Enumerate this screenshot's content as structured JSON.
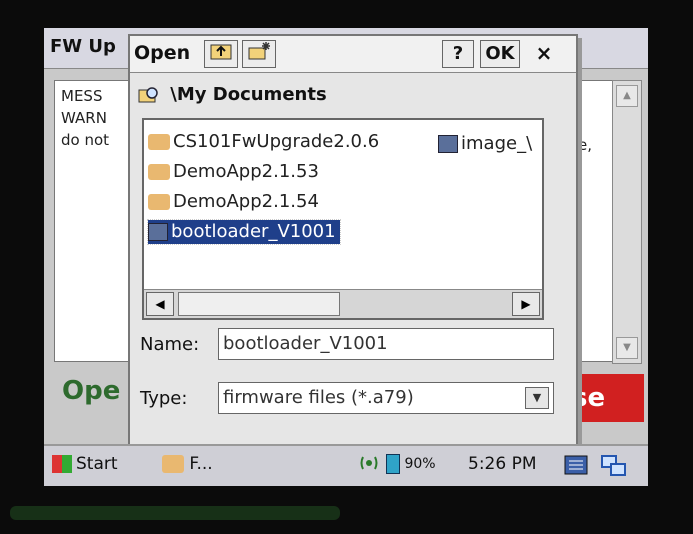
{
  "background_app": {
    "title": "FW Up",
    "lines": [
      "MESS",
      "WARN",
      "do not"
    ],
    "right_text": "e,",
    "open_button": "Ope",
    "close_button": "se",
    "scroll_up": "▲",
    "scroll_down": "▼"
  },
  "dialog": {
    "title": "Open",
    "help_label": "?",
    "ok_label": "OK",
    "close_label": "×",
    "path": "\\My Documents",
    "files": [
      {
        "name": "CS101FwUpgrade2.0.6",
        "type": "folder"
      },
      {
        "name": "DemoApp2.1.53",
        "type": "folder"
      },
      {
        "name": "DemoApp2.1.54",
        "type": "folder"
      },
      {
        "name": "bootloader_V1001",
        "type": "file",
        "selected": true
      },
      {
        "name": "image_\\",
        "type": "file"
      }
    ],
    "scroll_left": "◀",
    "scroll_right": "▶",
    "name_label": "Name:",
    "name_value": "bootloader_V1001",
    "type_label": "Type:",
    "type_value": "firmware files (*.a79)",
    "type_dropdown_icon": "▼"
  },
  "taskbar": {
    "start_label": "Start",
    "task_label": "F...",
    "battery": "90%",
    "time": "5:26 PM"
  },
  "colors": {
    "selection": "#1f3f8a",
    "close_red": "#d12020",
    "open_green": "#2d6a2d"
  }
}
